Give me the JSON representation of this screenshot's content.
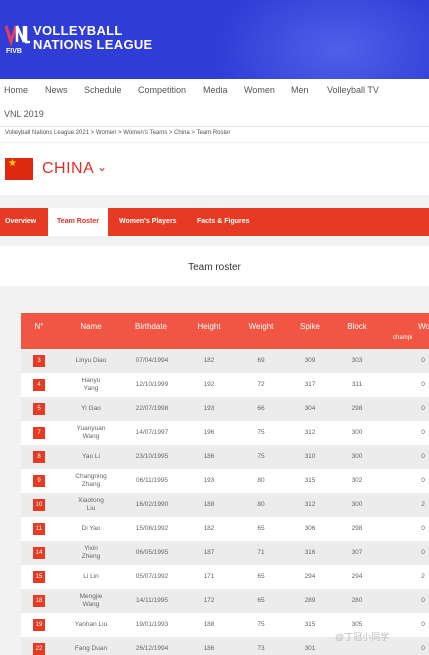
{
  "header": {
    "logo_line1": "VOLLEYBALL",
    "logo_line2": "NATIONS LEAGUE",
    "logo_mark_text": "VNL",
    "logo_sub": "FIVB",
    "bg_color": "#2f3cd6"
  },
  "nav": {
    "items": [
      "Home",
      "News",
      "Schedule",
      "Competition",
      "Media",
      "Women",
      "Men",
      "Volleyball TV"
    ],
    "second_row": "VNL 2019"
  },
  "breadcrumb": "Volleyball Nations League 2021 > Women > Women's Teams > China > Team Roster",
  "country": {
    "name": "CHINA",
    "flag_colors": [
      "#de2910",
      "#ffde00"
    ]
  },
  "tabs": [
    "Overview",
    "Team Roster",
    "Women's Players",
    "Facts & Figures"
  ],
  "roster_title": "Team roster",
  "table": {
    "headers": [
      "N°",
      "Name",
      "Birthdate",
      "Height",
      "Weight",
      "Spike",
      "Block",
      "Wo"
    ],
    "header_sub": "champi",
    "rows": [
      {
        "no": "3",
        "name": [
          "Linyu Diao"
        ],
        "birth": "07/04/1994",
        "height": "182",
        "weight": "69",
        "spike": "309",
        "block": "303",
        "extra": "0"
      },
      {
        "no": "4",
        "name": [
          "Hanyu",
          "Yang"
        ],
        "birth": "12/10/1999",
        "height": "192",
        "weight": "72",
        "spike": "317",
        "block": "311",
        "extra": "0"
      },
      {
        "no": "5",
        "name": [
          "Yi Gao"
        ],
        "birth": "22/07/1998",
        "height": "193",
        "weight": "66",
        "spike": "304",
        "block": "298",
        "extra": "0"
      },
      {
        "no": "7",
        "name": [
          "Yuanyuan",
          "Wang"
        ],
        "birth": "14/07/1997",
        "height": "196",
        "weight": "75",
        "spike": "312",
        "block": "300",
        "extra": "0"
      },
      {
        "no": "8",
        "name": [
          "Yao Li"
        ],
        "birth": "23/10/1995",
        "height": "186",
        "weight": "75",
        "spike": "310",
        "block": "300",
        "extra": "0"
      },
      {
        "no": "9",
        "name": [
          "Changning",
          "Zhang"
        ],
        "birth": "06/11/1995",
        "height": "193",
        "weight": "80",
        "spike": "315",
        "block": "302",
        "extra": "0"
      },
      {
        "no": "10",
        "name": [
          "Xiaotong",
          "Liu"
        ],
        "birth": "16/02/1990",
        "height": "188",
        "weight": "80",
        "spike": "312",
        "block": "300",
        "extra": "2"
      },
      {
        "no": "11",
        "name": [
          "Di Yao"
        ],
        "birth": "15/08/1992",
        "height": "182",
        "weight": "65",
        "spike": "306",
        "block": "298",
        "extra": "0"
      },
      {
        "no": "14",
        "name": [
          "Yixin",
          "Zheng"
        ],
        "birth": "06/05/1995",
        "height": "187",
        "weight": "71",
        "spike": "316",
        "block": "307",
        "extra": "0"
      },
      {
        "no": "15",
        "name": [
          "Li Lin"
        ],
        "birth": "05/07/1992",
        "height": "171",
        "weight": "65",
        "spike": "294",
        "block": "294",
        "extra": "2"
      },
      {
        "no": "18",
        "name": [
          "Mengjie",
          "Wang"
        ],
        "birth": "14/11/1995",
        "height": "172",
        "weight": "65",
        "spike": "289",
        "block": "280",
        "extra": "0"
      },
      {
        "no": "19",
        "name": [
          "Yanhan Liu"
        ],
        "birth": "19/01/1993",
        "height": "188",
        "weight": "75",
        "spike": "315",
        "block": "305",
        "extra": "0"
      },
      {
        "no": "22",
        "name": [
          "Fang Duan"
        ],
        "birth": "26/12/1994",
        "height": "186",
        "weight": "73",
        "spike": "301",
        "block": "",
        "extra": "0"
      }
    ]
  },
  "watermark": "@丁冠小同学"
}
